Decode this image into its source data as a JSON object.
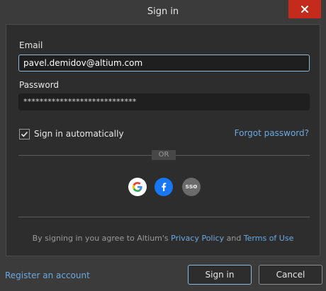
{
  "window": {
    "title": "Sign in"
  },
  "form": {
    "email_label": "Email",
    "email_value": "pavel.demidov@altium.com",
    "password_label": "Password",
    "password_value": "****************************",
    "auto_signin_label": "Sign in automatically",
    "auto_signin_checked": true,
    "forgot_password": "Forgot password?",
    "or_label": "OR"
  },
  "social": {
    "google": "G",
    "facebook": "f",
    "sso": "sso"
  },
  "agreement": {
    "prefix": "By signing in you agree to Altium's ",
    "privacy": "Privacy Policy",
    "and": " and ",
    "terms": "Terms of Use"
  },
  "footer": {
    "register": "Register an account",
    "signin": "Sign in",
    "cancel": "Cancel"
  },
  "colors": {
    "accent_link": "#6aa9e0",
    "close": "#c42b1c",
    "facebook": "#1877f2"
  }
}
